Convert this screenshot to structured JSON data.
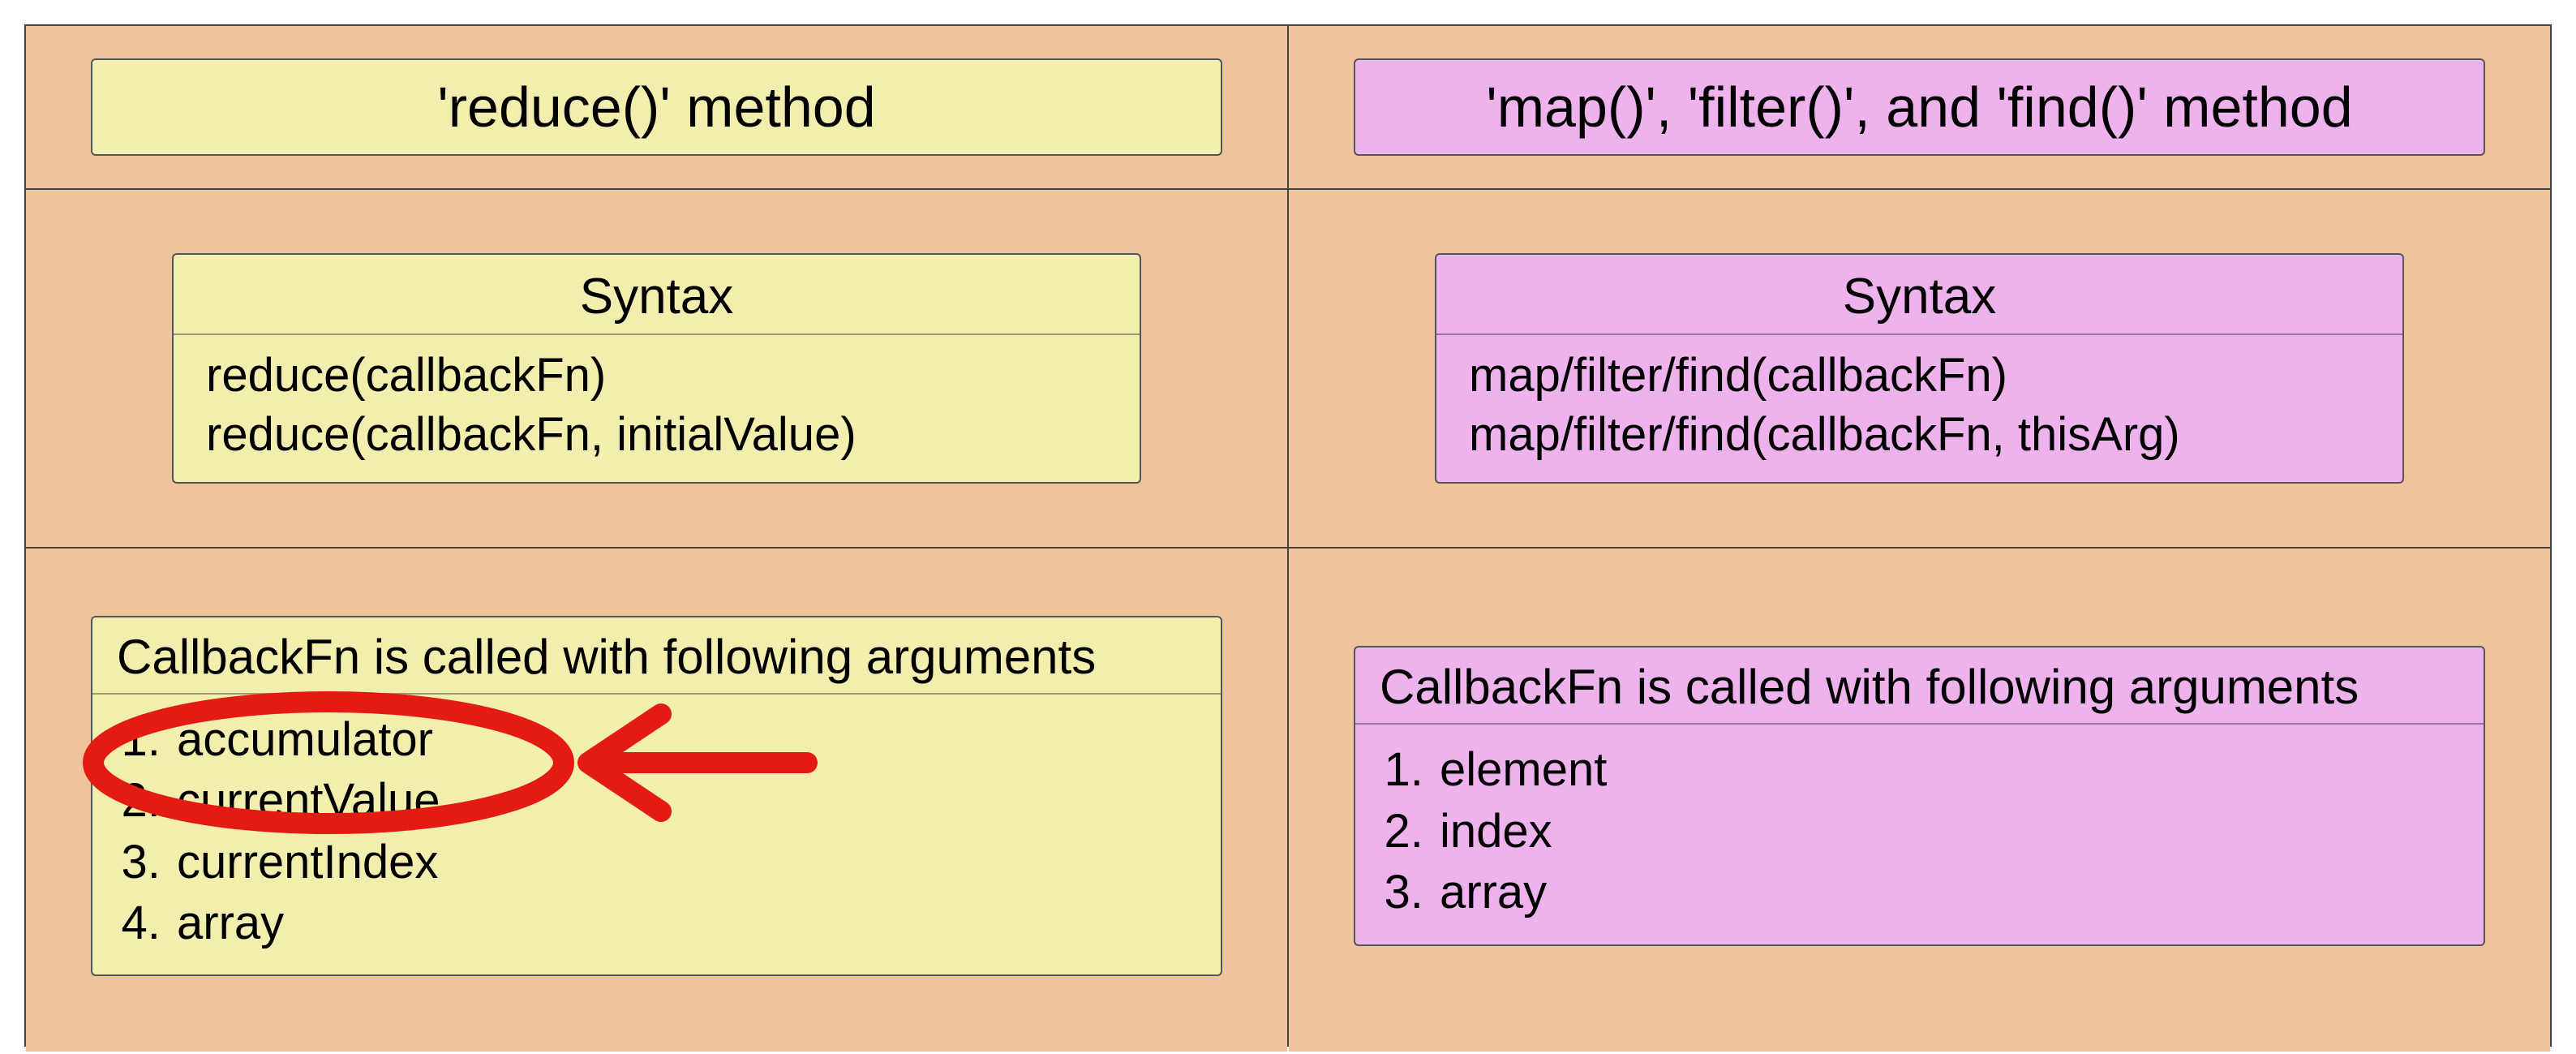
{
  "left": {
    "title": "'reduce()' method",
    "syntax_heading": "Syntax",
    "syntax_lines": [
      "reduce(callbackFn)",
      "reduce(callbackFn, initialValue)"
    ],
    "callback_heading": "CallbackFn is called with following arguments",
    "callback_args": [
      "accumulator",
      "currentValue",
      "currentIndex",
      "array"
    ]
  },
  "right": {
    "title": "'map()', 'filter()', and 'find()' method",
    "syntax_heading": "Syntax",
    "syntax_lines": [
      "map/filter/find(callbackFn)",
      "map/filter/find(callbackFn, thisArg)"
    ],
    "callback_heading": "CallbackFn is called with following arguments",
    "callback_args": [
      "element",
      "index",
      "array"
    ]
  },
  "colors": {
    "panel_bg": "#efc49c",
    "left_card": "#f2eeae",
    "right_card": "#eeb2ed",
    "annotation": "#e41b13"
  }
}
